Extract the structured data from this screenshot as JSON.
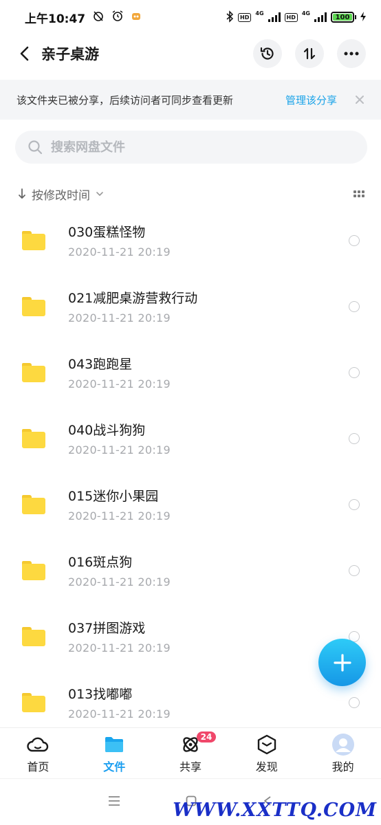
{
  "status": {
    "time": "上午10:47",
    "battery": "100",
    "net": "4G",
    "hd": "HD"
  },
  "header": {
    "title": "亲子桌游"
  },
  "banner": {
    "text": "该文件夹已被分享，后续访问者可同步查看更新",
    "link": "管理该分享"
  },
  "search": {
    "placeholder": "搜索网盘文件"
  },
  "sort": {
    "label": "按修改时间"
  },
  "files": [
    {
      "name": "030蛋糕怪物",
      "date": "2020-11-21  20:19"
    },
    {
      "name": "021减肥桌游营救行动",
      "date": "2020-11-21  20:19"
    },
    {
      "name": "043跑跑星",
      "date": "2020-11-21  20:19"
    },
    {
      "name": "040战斗狗狗",
      "date": "2020-11-21  20:19"
    },
    {
      "name": "015迷你小果园",
      "date": "2020-11-21  20:19"
    },
    {
      "name": "016斑点狗",
      "date": "2020-11-21  20:19"
    },
    {
      "name": "037拼图游戏",
      "date": "2020-11-21  20:19"
    },
    {
      "name": "013找嘟嘟",
      "date": "2020-11-21  20:19"
    }
  ],
  "tabs": [
    {
      "label": "首页",
      "icon": "cloud-icon"
    },
    {
      "label": "文件",
      "icon": "folder-icon"
    },
    {
      "label": "共享",
      "icon": "orbit-icon",
      "badge": "24"
    },
    {
      "label": "发现",
      "icon": "cube-icon"
    },
    {
      "label": "我的",
      "icon": "avatar-icon"
    }
  ],
  "watermark": "WWW.XXTTQ.COM",
  "colors": {
    "accent": "#1a9ef0",
    "folder": "#fdd940",
    "badge": "#f0476a"
  }
}
